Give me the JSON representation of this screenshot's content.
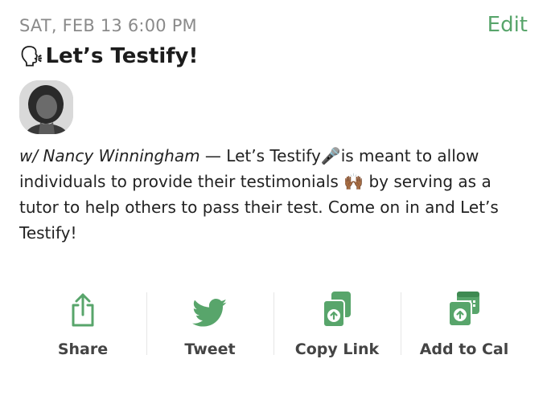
{
  "header": {
    "date": "SAT, FEB 13 6:00 PM",
    "edit_label": "Edit"
  },
  "event": {
    "title_emoji": "🗣",
    "title": "Let’s Testify!",
    "host": "w/ Nancy Winningham",
    "description": " — Let’s Testify🎤is meant to allow individuals to provide their testimonials 🙌🏾 by serving as a tutor to help others to pass their test. Come on in and Let’s Testify!"
  },
  "actions": [
    {
      "label": "Share",
      "icon": "share-icon"
    },
    {
      "label": "Tweet",
      "icon": "twitter-bird-icon"
    },
    {
      "label": "Copy Link",
      "icon": "copy-link-icon"
    },
    {
      "label": "Add to Cal",
      "icon": "add-to-calendar-icon"
    }
  ],
  "colors": {
    "accent": "#58a56b",
    "date": "#8a8a8a",
    "label": "#444444"
  }
}
